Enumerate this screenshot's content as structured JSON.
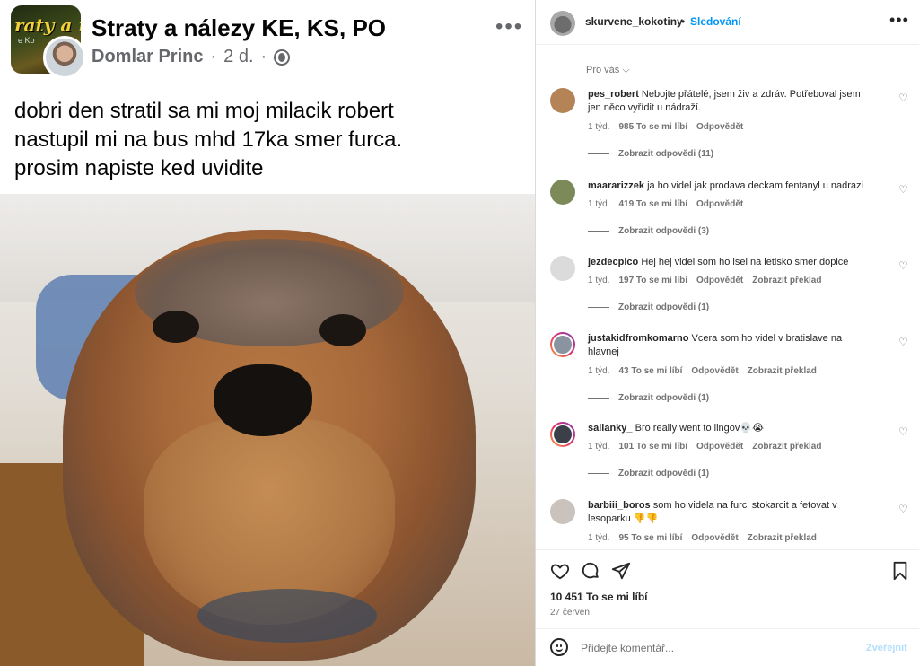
{
  "fb_post": {
    "group_name": "Straty a nálezy KE, KS, PO",
    "group_avatar_text": "raty a ná",
    "group_avatar_subtext": "e   Ko",
    "author": "Domlar Princ",
    "separator": "·",
    "age": "2 d.",
    "more_label": "•••",
    "text_lines": [
      "dobri den stratil sa mi moj milacik robert",
      "nastupil mi na bus mhd 17ka smer furca.",
      "prosim napiste ked uvidite"
    ]
  },
  "ig": {
    "header": {
      "username": "skurvene_kokotiny",
      "dot": "•",
      "follow_label": "Sledování",
      "more_label": "•••"
    },
    "for_you_label": "Pro vás ⌵",
    "comments": [
      {
        "username": "pes_robert",
        "text": "Nebojte přátelé, jsem živ a zdráv. Potřeboval jsem jen něco vyřídit u nádraží.",
        "time": "1 týd.",
        "likes": "985 To se mi líbí",
        "reply": "Odpovědět",
        "translate": "",
        "replies": "Zobrazit odpovědi (11)",
        "avatar_color": "#b48457"
      },
      {
        "username": "maararizzek",
        "text": "ja ho videl jak prodava deckam fentanyl u nadrazi",
        "time": "1 týd.",
        "likes": "419 To se mi líbí",
        "reply": "Odpovědět",
        "translate": "",
        "replies": "Zobrazit odpovědi (3)",
        "avatar_color": "#7c8a5a"
      },
      {
        "username": "jezdecpico",
        "text": "Hej hej videl som ho isel na letisko smer dopice",
        "time": "1 týd.",
        "likes": "197 To se mi líbí",
        "reply": "Odpovědět",
        "translate": "Zobrazit překlad",
        "replies": "Zobrazit odpovědi (1)",
        "avatar_color": "#dbdbdb"
      },
      {
        "username": "justakidfromkomarno",
        "text": "Vcera som ho videl v bratislave na hlavnej",
        "time": "1 týd.",
        "likes": "43 To se mi líbí",
        "reply": "Odpovědět",
        "translate": "Zobrazit překlad",
        "replies": "Zobrazit odpovědi (1)",
        "avatar_color": "#8a93a0"
      },
      {
        "username": "sallanky_",
        "text": "Bro really went to lingov💀😭",
        "time": "1 týd.",
        "likes": "101 To se mi líbí",
        "reply": "Odpovědět",
        "translate": "Zobrazit překlad",
        "replies": "Zobrazit odpovědi (1)",
        "avatar_color": "#3a3f4a"
      },
      {
        "username": "barbiii_boros",
        "text": "som ho videla na furci stokarcit a fetovat v lesoparku 👎👎",
        "time": "1 týd.",
        "likes": "95 To se mi líbí",
        "reply": "Odpovědět",
        "translate": "Zobrazit překlad",
        "replies": "",
        "avatar_color": "#c9c2bd"
      }
    ],
    "actions": {
      "like_icon": "heart-icon",
      "comment_icon": "comment-icon",
      "share_icon": "share-icon",
      "save_icon": "bookmark-icon"
    },
    "likes_total": "10 451 To se mi líbí",
    "date": "27 červen",
    "add_comment": {
      "placeholder": "Přidejte komentář...",
      "post_label": "Zveřejnit"
    },
    "colors": {
      "accent": "#0095f6",
      "post_disabled": "#b2dffc"
    }
  }
}
